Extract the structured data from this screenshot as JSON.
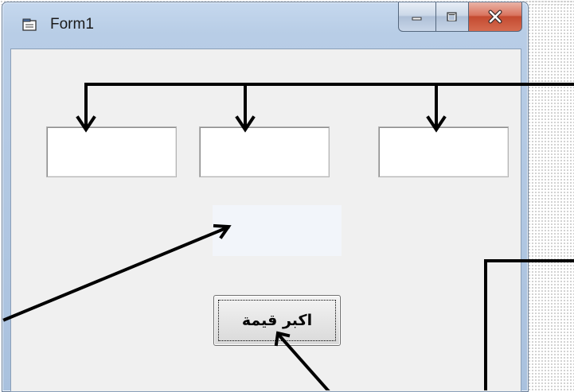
{
  "window": {
    "title": "Form1",
    "app_icon": "form-icon",
    "controls": {
      "minimize_icon": "minimize-icon",
      "maximize_icon": "maximize-icon",
      "close_icon": "close-icon"
    }
  },
  "form": {
    "textboxes": [
      {
        "value": ""
      },
      {
        "value": ""
      },
      {
        "value": ""
      }
    ],
    "result_label": "",
    "button_label": "اكبر قيمة"
  },
  "colors": {
    "client_bg": "#f0f0f0",
    "title_bar": "#b8cde6",
    "close_button": "#c44a30",
    "arrow": "#000000"
  }
}
